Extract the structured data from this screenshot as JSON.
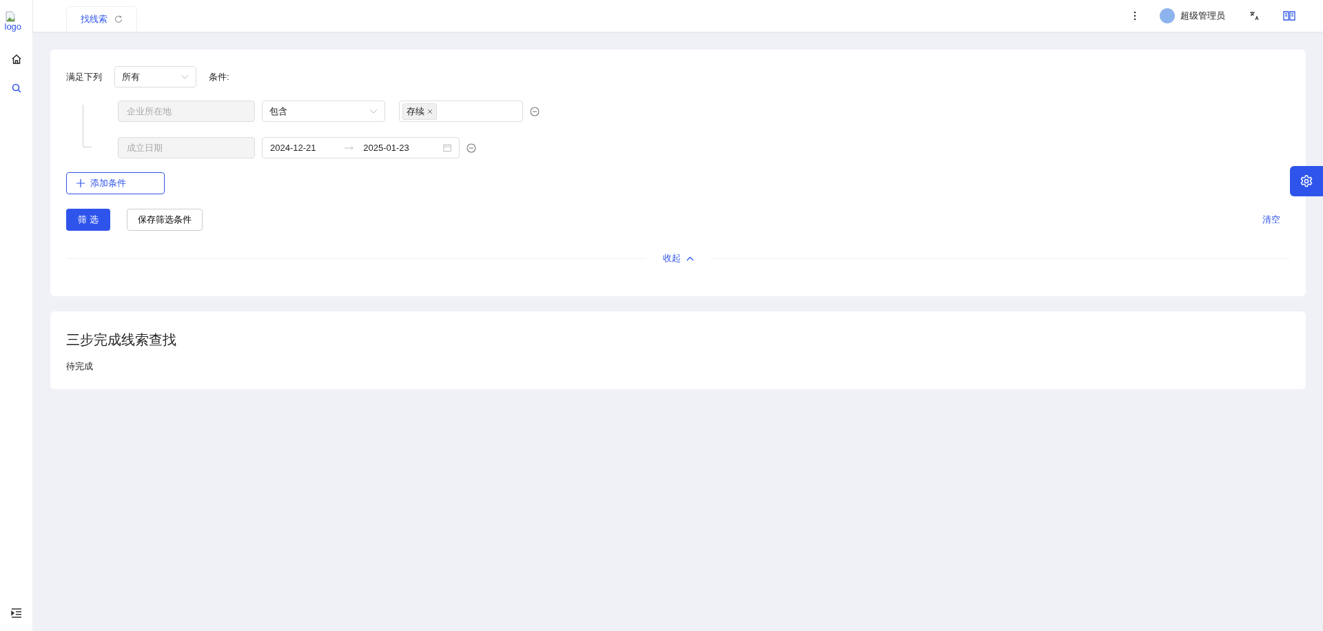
{
  "sidebar": {
    "logo_alt": "logo",
    "items": [
      {
        "kind": "home",
        "selected": false
      },
      {
        "kind": "search",
        "selected": true
      }
    ]
  },
  "tabs": [
    {
      "label": "找线索",
      "selected": true
    }
  ],
  "header": {
    "user_name": "超级管理员"
  },
  "filter": {
    "match_label": "满足下列",
    "match_select": "所有",
    "condition_label": "条件:",
    "conditions": [
      {
        "kind": "select",
        "field": "企业所在地",
        "operator": "包含",
        "tags": [
          "存续"
        ]
      },
      {
        "kind": "date_range",
        "field": "成立日期",
        "start": "2024-12-21",
        "end": "2025-01-23"
      }
    ],
    "add_button": "添加条件",
    "filter_button": "筛 选",
    "save_button": "保存筛选条件",
    "clear_link": "清空",
    "collapse_link": "收起"
  },
  "guide": {
    "title": "三步完成线索查找",
    "status": "待完成"
  }
}
